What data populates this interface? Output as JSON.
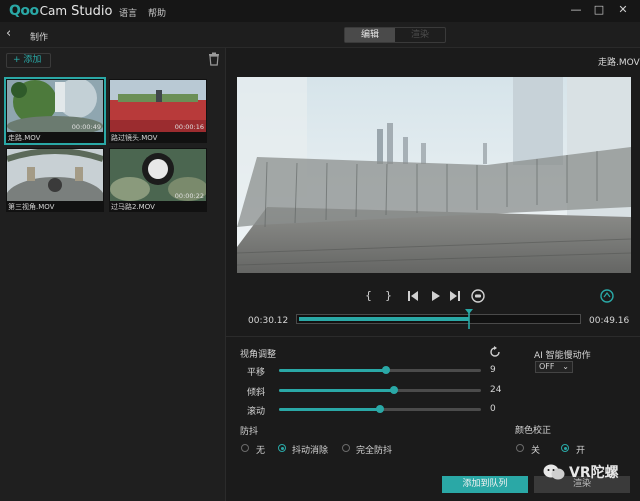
{
  "app": {
    "logo_q": "Qoo",
    "logo_cam": "Cam",
    "logo_studio": "Studio"
  },
  "menu": {
    "language": "语言",
    "help": "帮助"
  },
  "toolbar": {
    "section": "制作",
    "tab_edit": "编辑",
    "tab_render": "渲染"
  },
  "library": {
    "add_label": "+ 添加",
    "clips": [
      {
        "name": "走路.MOV",
        "duration": "00:00:49",
        "selected": true
      },
      {
        "name": "路过镜头.MOV",
        "duration": "00:00:16",
        "selected": false
      },
      {
        "name": "第三视角.MOV",
        "duration": "",
        "selected": false
      },
      {
        "name": "过马路2.MOV",
        "duration": "00:00:22",
        "selected": false
      }
    ]
  },
  "preview": {
    "filename": "走路.MOV"
  },
  "playback": {
    "mark_in": "{",
    "mark_out": "}",
    "current_time": "00:30.12",
    "total_time": "00:49.16",
    "progress": 0.61
  },
  "view_adjust": {
    "title": "视角调整",
    "rows": [
      {
        "label": "平移",
        "value": "9",
        "fraction": 0.53
      },
      {
        "label": "倾斜",
        "value": "24",
        "fraction": 0.57
      },
      {
        "label": "滚动",
        "value": "0",
        "fraction": 0.5
      }
    ]
  },
  "ai_slow": {
    "title": "AI 智能慢动作",
    "value": "OFF"
  },
  "stabilize": {
    "title": "防抖",
    "options": [
      "无",
      "抖动消除",
      "完全防抖"
    ],
    "selected": 1
  },
  "color_correct": {
    "title": "颜色校正",
    "options": [
      "关",
      "开"
    ],
    "selected": 1
  },
  "actions": {
    "add_queue": "添加到队列",
    "render": "渲染"
  },
  "watermark": {
    "text": "VR陀螺"
  },
  "colors": {
    "accent": "#2aa8a6",
    "bg": "#1b1b1b",
    "panel": "#1f1f1f"
  }
}
